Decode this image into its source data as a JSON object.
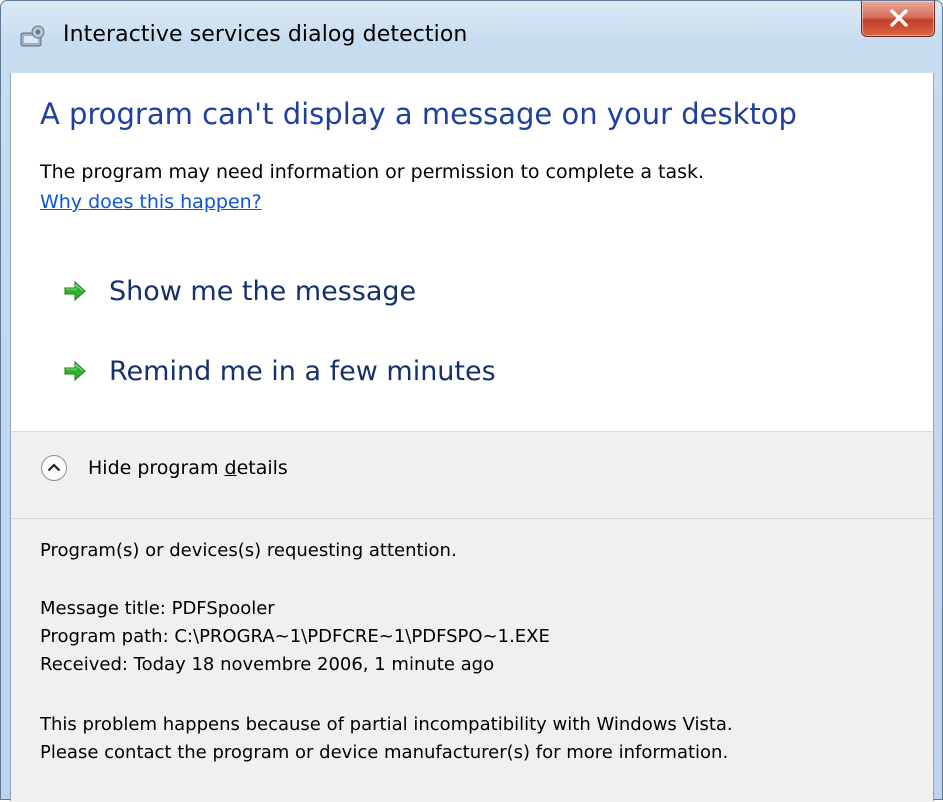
{
  "window": {
    "title": "Interactive services dialog detection",
    "icons": {
      "app": "services-icon",
      "close": "close-icon"
    }
  },
  "main": {
    "heading": "A program can't display a message on your desktop",
    "description": "The program may need information or permission to complete a task.",
    "why_link": "Why does this happen?",
    "commands": [
      {
        "label": "Show me the message",
        "icon": "green-arrow-icon"
      },
      {
        "label": "Remind me in a few minutes",
        "icon": "green-arrow-icon"
      }
    ]
  },
  "details": {
    "toggle_label_pre": "Hide program ",
    "toggle_label_access": "d",
    "toggle_label_post": "etails",
    "toggle_icon": "chevron-up-icon",
    "requesting": "Program(s) or devices(s) requesting attention.",
    "message_title": "Message title:  PDFSpooler",
    "program_path": "Program path:  C:\\PROGRA~1\\PDFCRE~1\\PDFSPO~1.EXE",
    "received": "Received:  Today 18 novembre 2006, 1 minute ago",
    "problem_line1": "This problem happens because of partial incompatibility with Windows Vista.",
    "problem_line2": "Please contact the program or device manufacturer(s) for more information."
  },
  "colors": {
    "heading": "#1e3f9e",
    "link": "#0a56d6",
    "command": "#15306b",
    "arrow": "#2bb52b",
    "details_bg": "#f0f0f0",
    "close_button": "#c1402a"
  }
}
